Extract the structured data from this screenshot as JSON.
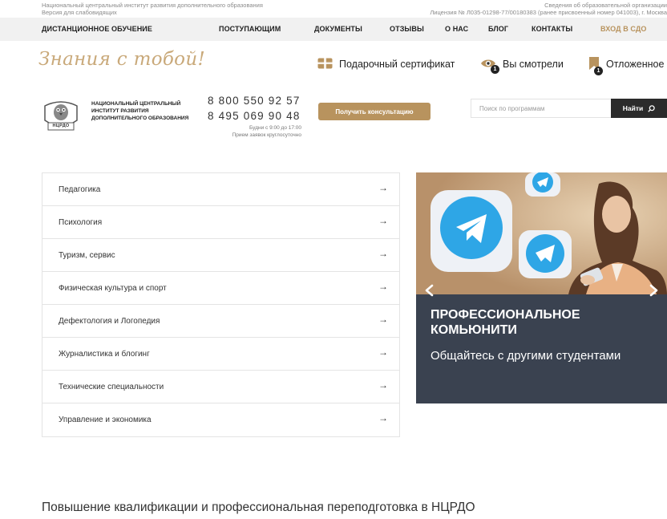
{
  "topbar": {
    "left_line1": "Национальный центральный институт развития дополнительного образования",
    "left_line2": "Версия для слабовидящих",
    "right_line1": "Сведения об образовательной организации",
    "right_line2": "Лицензия № Л035-01298-77/00180383 (ранее присвоенный номер 041003), г. Москва"
  },
  "nav": {
    "items": [
      {
        "label": "ДИСТАНЦИОННОЕ ОБУЧЕНИЕ"
      },
      {
        "label": "ПОСТУПАЮЩИМ"
      },
      {
        "label": "ДОКУМЕНТЫ"
      },
      {
        "label": "ОТЗЫВЫ"
      },
      {
        "label": "О НАС"
      },
      {
        "label": "БЛОГ"
      },
      {
        "label": "КОНТАКТЫ"
      },
      {
        "label": "ВХОД В СДО"
      }
    ]
  },
  "brand": {
    "slogan": "Знания с тобой!",
    "tools": {
      "gift": "Подарочный сертификат",
      "viewed": "Вы смотрели",
      "viewed_count": "1",
      "saved": "Отложенное",
      "saved_count": "1"
    }
  },
  "header": {
    "logo_text": "НЦРДО",
    "org_name": "НАЦИОНАЛЬНЫЙ ЦЕНТРАЛЬНЫЙ ИНСТИТУТ РАЗВИТИЯ ДОПОЛНИТЕЛЬНОГО ОБРАЗОВАНИЯ",
    "phone1": "8 800 550 92 57",
    "phone2": "8 495 069 90 48",
    "hours1": "Будни с 9:00 до 17:00",
    "hours2": "Прием заявок круглосуточно",
    "consult_button": "Получить консультацию",
    "search_placeholder": "Поиск по программам",
    "search_button": "Найти"
  },
  "categories": [
    {
      "label": "Педагогика",
      "arrow": "→"
    },
    {
      "label": "Психология",
      "arrow": "→"
    },
    {
      "label": "Туризм, сервис",
      "arrow": "→"
    },
    {
      "label": "Физическая культура и спорт",
      "arrow": "→"
    },
    {
      "label": "Дефектология и Логопедия",
      "arrow": "→"
    },
    {
      "label": "Журналистика и блогинг",
      "arrow": "→"
    },
    {
      "label": "Технические специальности",
      "arrow": "→"
    },
    {
      "label": "Управление и экономика",
      "arrow": "→"
    }
  ],
  "banner": {
    "title": "ПРОФЕССИОНАЛЬНОЕ КОМЬЮНИТИ",
    "subtitle": "Общайтесь с другими студентами"
  },
  "section": {
    "title": "Повышение квалификации и профессиональная переподготовка в НЦРДО"
  },
  "colors": {
    "accent": "#b8935e",
    "nav_bg": "#f1f1f1",
    "banner_panel": "#3a4250",
    "banner_scene": "#c6a47b",
    "telegram_blue": "#2ea6e6"
  }
}
